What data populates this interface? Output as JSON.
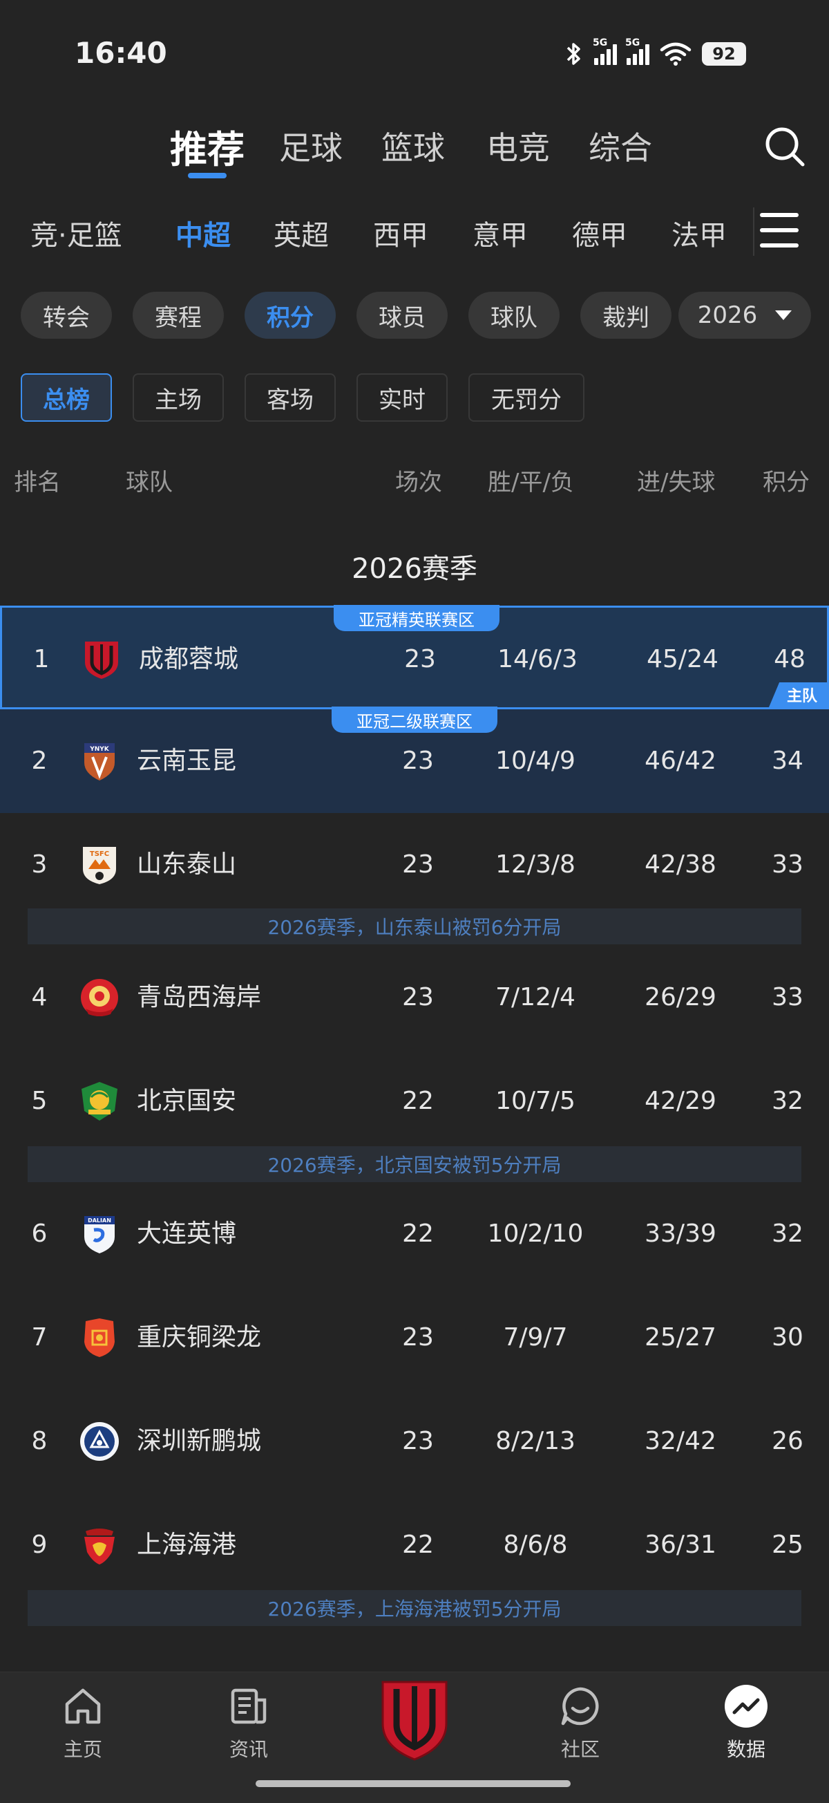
{
  "status_bar": {
    "time": "16:40",
    "signal_1": "5G",
    "signal_2": "5G",
    "battery": "92"
  },
  "top_tabs": [
    {
      "label": "推荐",
      "active": true
    },
    {
      "label": "足球",
      "active": false
    },
    {
      "label": "篮球",
      "active": false
    },
    {
      "label": "电竞",
      "active": false
    },
    {
      "label": "综合",
      "active": false
    }
  ],
  "league_tabs": [
    {
      "label": "竞·足篮"
    },
    {
      "label": "中超",
      "active": true
    },
    {
      "label": "英超"
    },
    {
      "label": "西甲"
    },
    {
      "label": "意甲"
    },
    {
      "label": "德甲"
    },
    {
      "label": "法甲"
    }
  ],
  "category_pills": [
    {
      "label": "转会"
    },
    {
      "label": "赛程"
    },
    {
      "label": "积分",
      "active": true
    },
    {
      "label": "球员"
    },
    {
      "label": "球队"
    },
    {
      "label": "裁判"
    }
  ],
  "year_select": {
    "value": "2026"
  },
  "sub_tabs": [
    {
      "label": "总榜",
      "active": true
    },
    {
      "label": "主场"
    },
    {
      "label": "客场"
    },
    {
      "label": "实时"
    },
    {
      "label": "无罚分"
    }
  ],
  "table": {
    "headers": {
      "rank": "排名",
      "team": "球队",
      "played": "场次",
      "wdl": "胜/平/负",
      "goals": "进/失球",
      "points": "积分"
    },
    "season_title": "2026赛季",
    "zones": {
      "acl_elite": "亚冠精英联赛区",
      "acl_two": "亚冠二级联赛区"
    },
    "home_mark": "主队",
    "rows": [
      {
        "rank": "1",
        "team": "成都蓉城",
        "played": "23",
        "wdl": "14/6/3",
        "goals": "45/24",
        "points": "48"
      },
      {
        "rank": "2",
        "team": "云南玉昆",
        "played": "23",
        "wdl": "10/4/9",
        "goals": "46/42",
        "points": "34"
      },
      {
        "rank": "3",
        "team": "山东泰山",
        "played": "23",
        "wdl": "12/3/8",
        "goals": "42/38",
        "points": "33"
      },
      {
        "rank": "4",
        "team": "青岛西海岸",
        "played": "23",
        "wdl": "7/12/4",
        "goals": "26/29",
        "points": "33"
      },
      {
        "rank": "5",
        "team": "北京国安",
        "played": "22",
        "wdl": "10/7/5",
        "goals": "42/29",
        "points": "32"
      },
      {
        "rank": "6",
        "team": "大连英博",
        "played": "22",
        "wdl": "10/2/10",
        "goals": "33/39",
        "points": "32"
      },
      {
        "rank": "7",
        "team": "重庆铜梁龙",
        "played": "23",
        "wdl": "7/9/7",
        "goals": "25/27",
        "points": "30"
      },
      {
        "rank": "8",
        "team": "深圳新鹏城",
        "played": "23",
        "wdl": "8/2/13",
        "goals": "32/42",
        "points": "26"
      },
      {
        "rank": "9",
        "team": "上海海港",
        "played": "22",
        "wdl": "8/6/8",
        "goals": "36/31",
        "points": "25"
      }
    ],
    "notes": [
      "2026赛季，山东泰山被罚6分开局",
      "2026赛季，北京国安被罚5分开局",
      "2026赛季，上海海港被罚5分开局"
    ]
  },
  "bottom_nav": [
    {
      "label": "主页",
      "icon": "home-icon"
    },
    {
      "label": "资讯",
      "icon": "news-icon"
    },
    {
      "label": "",
      "icon": "team-logo-icon"
    },
    {
      "label": "社区",
      "icon": "chat-icon"
    },
    {
      "label": "数据",
      "icon": "data-icon",
      "active": true
    }
  ],
  "colors": {
    "accent": "#3b8ef0",
    "background": "#242424",
    "highlight_row": "#1f3754"
  }
}
